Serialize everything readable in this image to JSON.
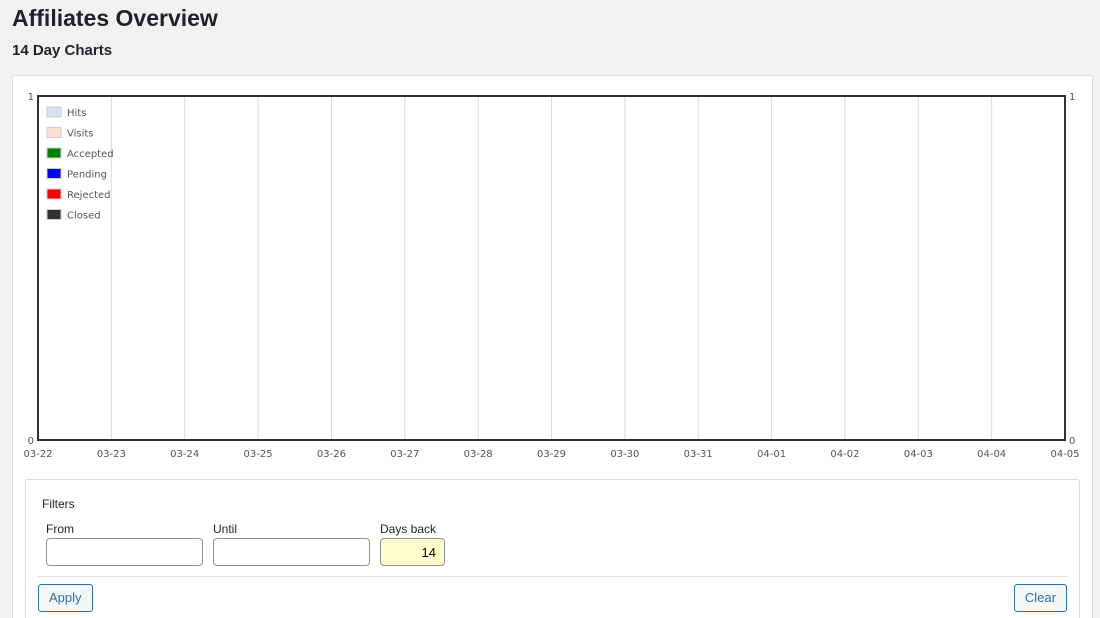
{
  "page": {
    "title": "Affiliates Overview",
    "section_title": "14 Day Charts"
  },
  "chart_data": {
    "type": "line",
    "x": [
      "03-22",
      "03-23",
      "03-24",
      "03-25",
      "03-26",
      "03-27",
      "03-28",
      "03-29",
      "03-30",
      "03-31",
      "04-01",
      "04-02",
      "04-03",
      "04-04",
      "04-05"
    ],
    "ylim": [
      0,
      1
    ],
    "y_ticks": [
      "0",
      "1"
    ],
    "y2_ticks": [
      "0",
      "1"
    ],
    "grid": true,
    "legend_position": "top-left",
    "series": [
      {
        "name": "Hits",
        "color": "#d5e1f6",
        "values": []
      },
      {
        "name": "Visits",
        "color": "#fbe0d4",
        "values": []
      },
      {
        "name": "Accepted",
        "color": "#008000",
        "values": []
      },
      {
        "name": "Pending",
        "color": "#0000ff",
        "values": []
      },
      {
        "name": "Rejected",
        "color": "#ff0000",
        "values": []
      },
      {
        "name": "Closed",
        "color": "#333333",
        "values": []
      }
    ]
  },
  "filters": {
    "heading": "Filters",
    "from": {
      "label": "From",
      "value": ""
    },
    "until": {
      "label": "Until",
      "value": ""
    },
    "days_back": {
      "label": "Days back",
      "value": "14"
    },
    "apply_label": "Apply",
    "clear_label": "Clear"
  }
}
